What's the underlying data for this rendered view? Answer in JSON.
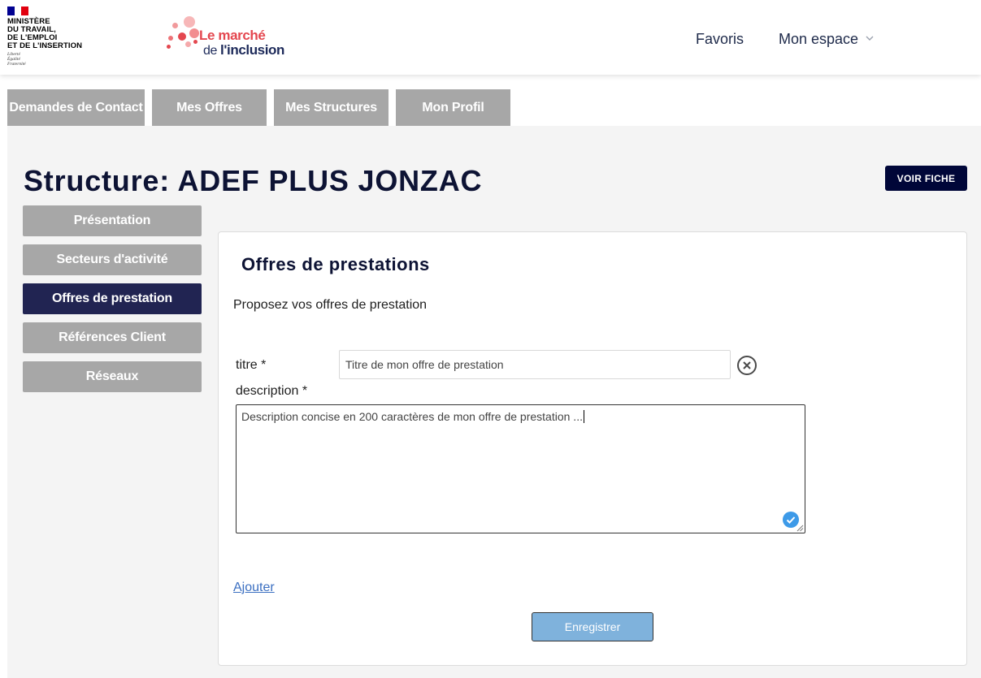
{
  "header": {
    "ministry": {
      "lines": [
        "MINISTÈRE",
        "DU TRAVAIL,",
        "DE L'EMPLOI",
        "ET DE L'INSERTION"
      ],
      "motto": [
        "Liberté",
        "Égalité",
        "Fraternité"
      ]
    },
    "site_logo": {
      "line1": "Le marché",
      "line2_prefix": "de ",
      "line2_bold": "l'inclusion"
    },
    "nav": {
      "favoris": "Favoris",
      "mon_espace": "Mon espace"
    }
  },
  "tabs": [
    {
      "label": "Demandes de Contact"
    },
    {
      "label": "Mes Offres"
    },
    {
      "label": "Mes Structures"
    },
    {
      "label": "Mon Profil"
    }
  ],
  "page": {
    "title": "Structure: ADEF PLUS JONZAC",
    "voir_fiche": "VOIR FICHE"
  },
  "sidebar": {
    "items": [
      {
        "label": "Présentation",
        "active": false
      },
      {
        "label": "Secteurs d'activité",
        "active": false
      },
      {
        "label": "Offres de prestation",
        "active": true
      },
      {
        "label": "Références Client",
        "active": false
      },
      {
        "label": "Réseaux",
        "active": false
      }
    ]
  },
  "form": {
    "title": "Offres de prestations",
    "intro": "Proposez vos offres de prestation",
    "titre_label": "titre *",
    "titre_value": "Titre de mon offre de prestation",
    "description_label": "description *",
    "description_value": "Description concise en 200 caractères de mon offre de prestation ...",
    "add_link": "Ajouter",
    "save_button": "Enregistrer"
  },
  "colors": {
    "tab_bg": "#a7a7a7",
    "active_nav": "#212452",
    "title": "#0d1334",
    "voir_fiche_bg": "#000638",
    "save_bg": "#7fb2dc",
    "link": "#3b6fc1",
    "brand_red": "#e4474f"
  },
  "icons": {
    "clear": "close-circle-icon",
    "valid": "check-circle-icon",
    "dropdown": "chevron-down-icon"
  }
}
